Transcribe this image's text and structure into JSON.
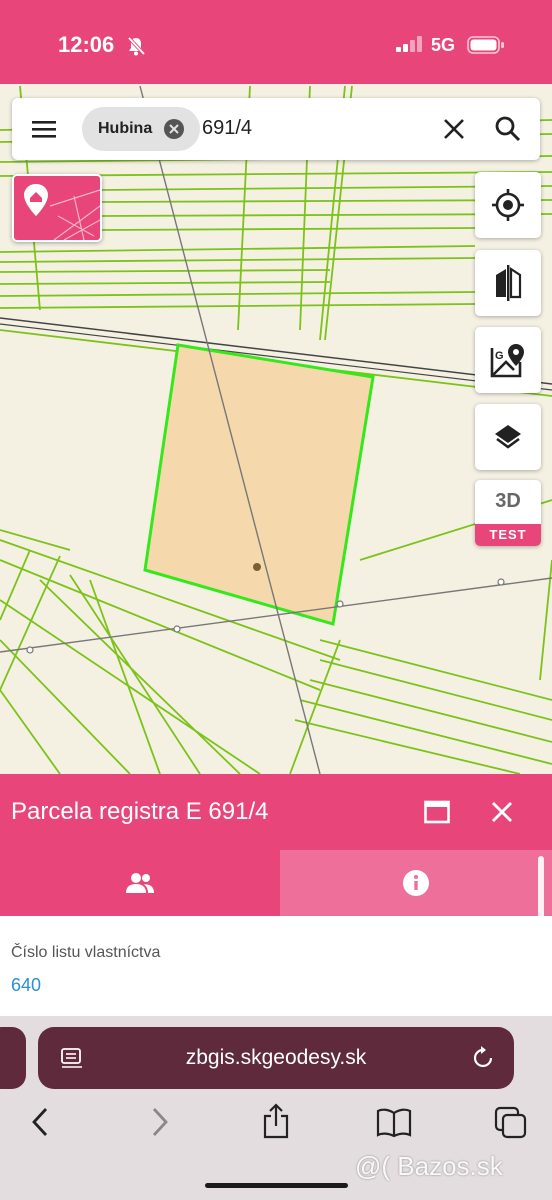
{
  "status_bar": {
    "time": "12:06",
    "network": "5G"
  },
  "search": {
    "chip_label": "Hubina",
    "query": "691/4"
  },
  "map_controls": {
    "three_d_label": "3D",
    "three_d_badge": "TEST"
  },
  "panel": {
    "title": "Parcela registra E 691/4",
    "field_label": "Číslo listu vlastníctva",
    "field_value": "640"
  },
  "browser": {
    "url": "zbgis.skgeodesy.sk"
  },
  "watermark": "@( Bazos.sk",
  "colors": {
    "brand_pink": "#e8467a",
    "parcel_fill": "#f5d9ac",
    "parcel_outline": "#35e81b",
    "boundary_green": "#7cc21a"
  }
}
